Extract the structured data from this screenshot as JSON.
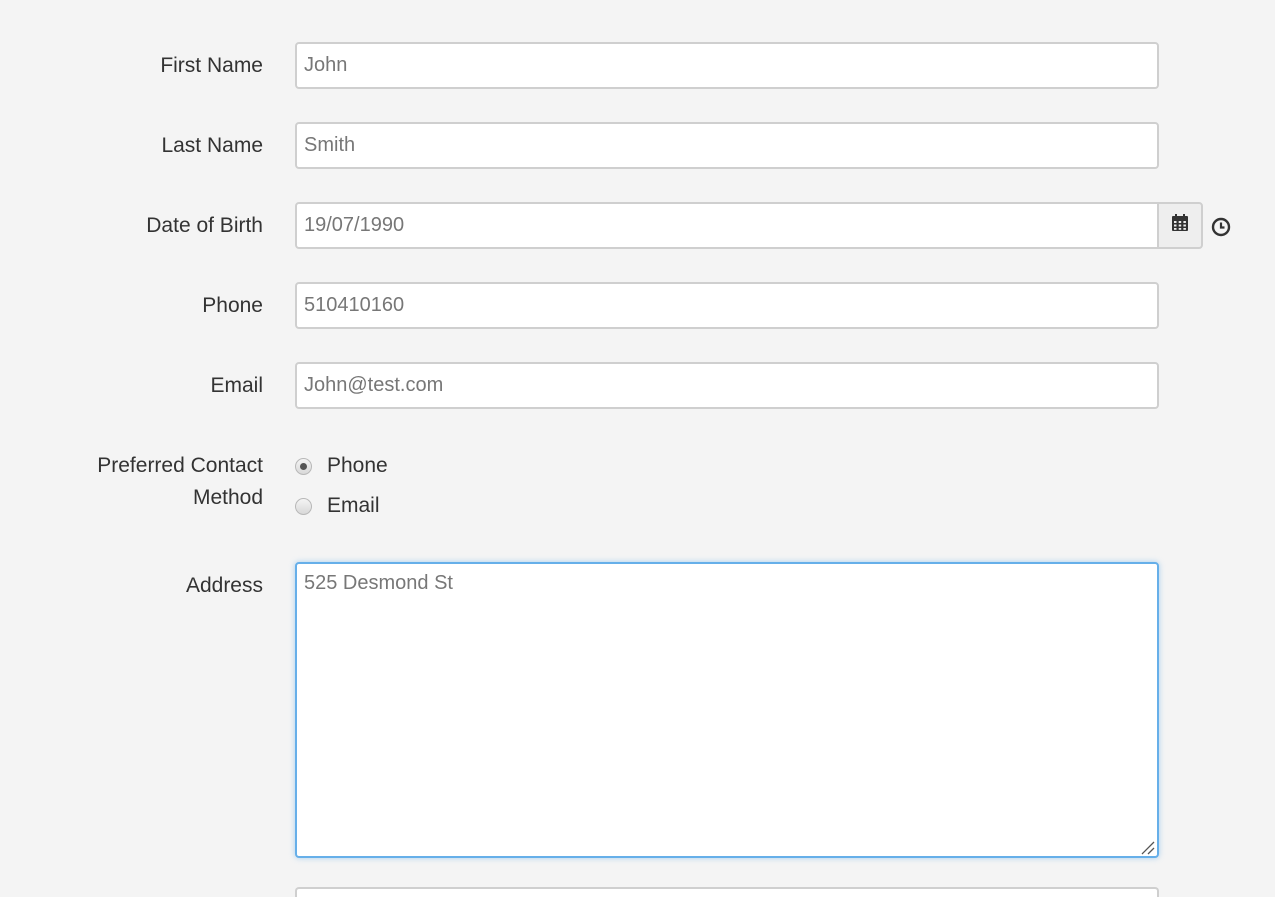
{
  "form": {
    "first_name": {
      "label": "First Name",
      "value": "John"
    },
    "last_name": {
      "label": "Last Name",
      "value": "Smith"
    },
    "dob": {
      "label": "Date of Birth",
      "value": "19/07/1990",
      "calendar_icon": "calendar-icon",
      "clock_icon": "clock-icon"
    },
    "phone": {
      "label": "Phone",
      "value": "510410160"
    },
    "email": {
      "label": "Email",
      "value": "John@test.com"
    },
    "contact_method": {
      "label_line1": "Preferred Contact",
      "label_line2": "Method",
      "options": [
        {
          "label": "Phone",
          "checked": true
        },
        {
          "label": "Email",
          "checked": false
        }
      ]
    },
    "address": {
      "label": "Address",
      "value": "525 Desmond St"
    }
  },
  "colors": {
    "background": "#f4f4f4",
    "input_border": "#cfcfcf",
    "focus_border": "#66afe9"
  }
}
